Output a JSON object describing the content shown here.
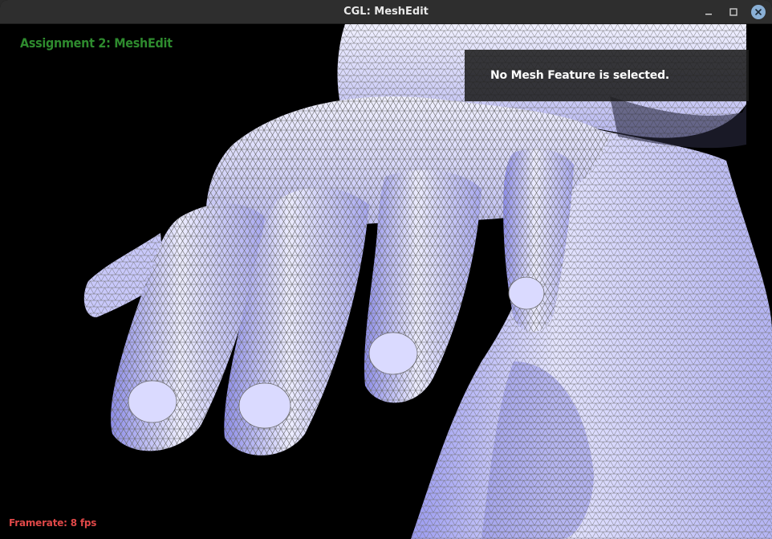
{
  "window": {
    "title": "CGL: MeshEdit",
    "controls": [
      "minimize-icon",
      "maximize-icon",
      "close-icon"
    ]
  },
  "overlay": {
    "app_title": "Assignment 2: MeshEdit",
    "info_message": "No Mesh Feature is selected.",
    "framerate": "Framerate: 8 fps"
  },
  "colors": {
    "background": "#000000",
    "mesh_fill": "#d8d8ff",
    "mesh_shade": "#8a8ae8",
    "wireframe": "#6e6e6e",
    "title_green": "#2e8b2e",
    "framerate_red": "#e04848",
    "close_button": "#8ab0d6"
  }
}
